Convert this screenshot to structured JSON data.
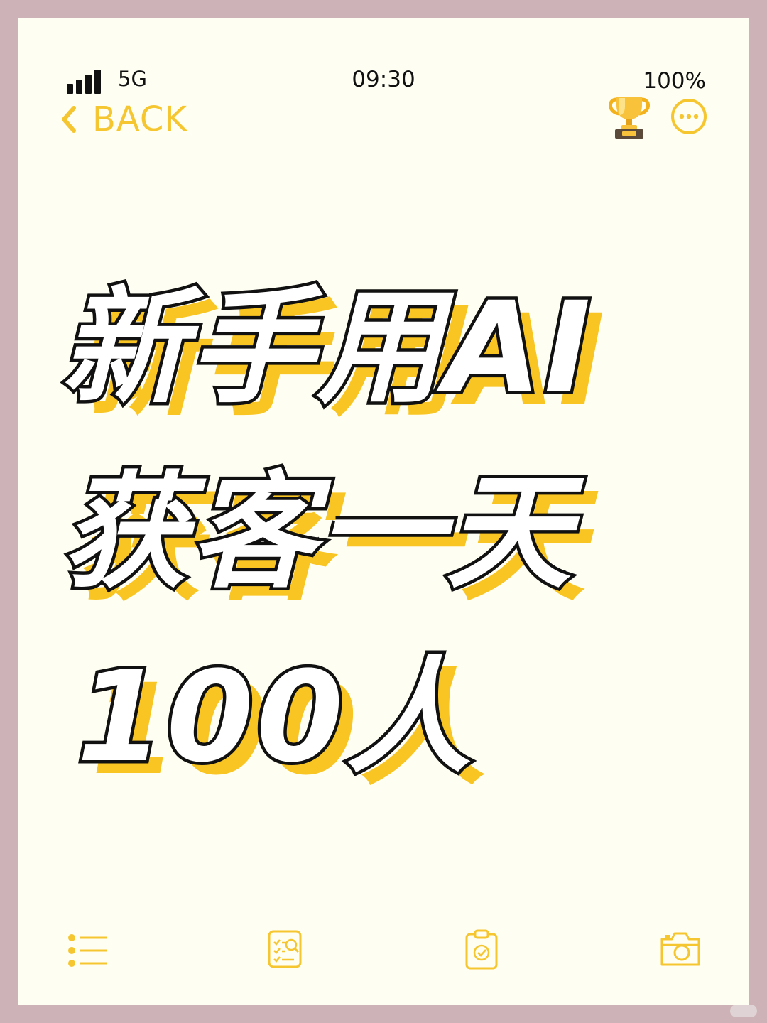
{
  "status_bar": {
    "network": "5G",
    "time": "09:30",
    "battery": "100%"
  },
  "nav": {
    "back_label": "BACK",
    "back_icon": "chevron-left-icon",
    "trophy_icon": "trophy-icon",
    "more_icon": "more-horizontal-icon"
  },
  "headline": {
    "line1": "新手用AI",
    "line2": "获客一天",
    "line3": "100人"
  },
  "toolbar": {
    "items": [
      {
        "icon": "list-icon"
      },
      {
        "icon": "search-checklist-icon"
      },
      {
        "icon": "clipboard-check-icon"
      },
      {
        "icon": "camera-icon"
      }
    ]
  },
  "colors": {
    "frame": "#cdb3b7",
    "screen": "#fefef3",
    "accent": "#f6c631",
    "headline_shadow": "#f9c523",
    "headline_fill": "#ffffff",
    "headline_stroke": "#111111"
  }
}
